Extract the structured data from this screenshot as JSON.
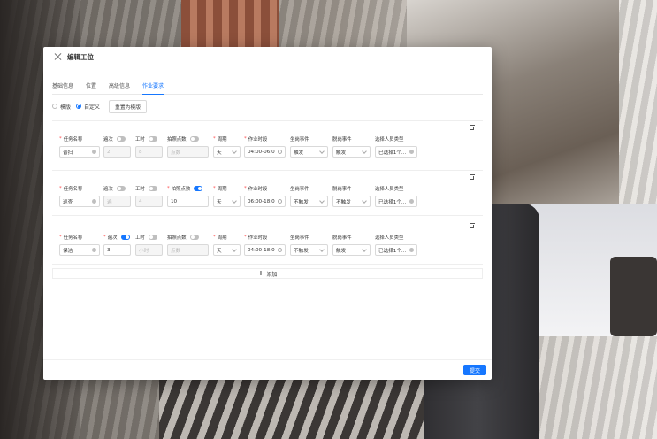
{
  "modal": {
    "title": "编辑工位"
  },
  "tabs": [
    {
      "label": "基础信息"
    },
    {
      "label": "位置"
    },
    {
      "label": "高级信息"
    },
    {
      "label": "作业要求",
      "active": true
    }
  ],
  "mode": {
    "options": [
      "模版",
      "自定义"
    ],
    "selected": "自定义",
    "reset_label": "重置为模版"
  },
  "labels": {
    "task_name": "任务名称",
    "count": "遍次",
    "hours": "工时",
    "photo_points": "拍照点数",
    "cycle": "周期",
    "work_time": "作业时段",
    "on_post": "坐岗事件",
    "off_post": "脱岗事件",
    "people_type": "选择人员类型"
  },
  "tasks": [
    {
      "name": "普扫",
      "count_on": false,
      "count": "2",
      "hours_on": false,
      "hours": "8",
      "photo_on": false,
      "photo": "点数",
      "cycle": "天",
      "work_time": "04:00-06:0",
      "on_post": "触发",
      "off_post": "触发",
      "people": "已选择1个..."
    },
    {
      "name": "巡查",
      "count_on": false,
      "count": "遍",
      "hours_on": false,
      "hours": "4",
      "photo_on": true,
      "photo": "10",
      "cycle": "天",
      "work_time": "06:00-18:0",
      "on_post": "不触发",
      "off_post": "不触发",
      "people": "已选择1个..."
    },
    {
      "name": "保洁",
      "count_on": true,
      "count": "3",
      "hours_on": false,
      "hours": "小时",
      "photo_on": false,
      "photo": "点数",
      "cycle": "天",
      "work_time": "04:00-18:0",
      "on_post": "不触发",
      "off_post": "触发",
      "people": "已选择1个..."
    }
  ],
  "add_label": "添加",
  "submit_label": "提交",
  "colors": {
    "primary": "#1677ff",
    "required": "#ff4d4f"
  }
}
